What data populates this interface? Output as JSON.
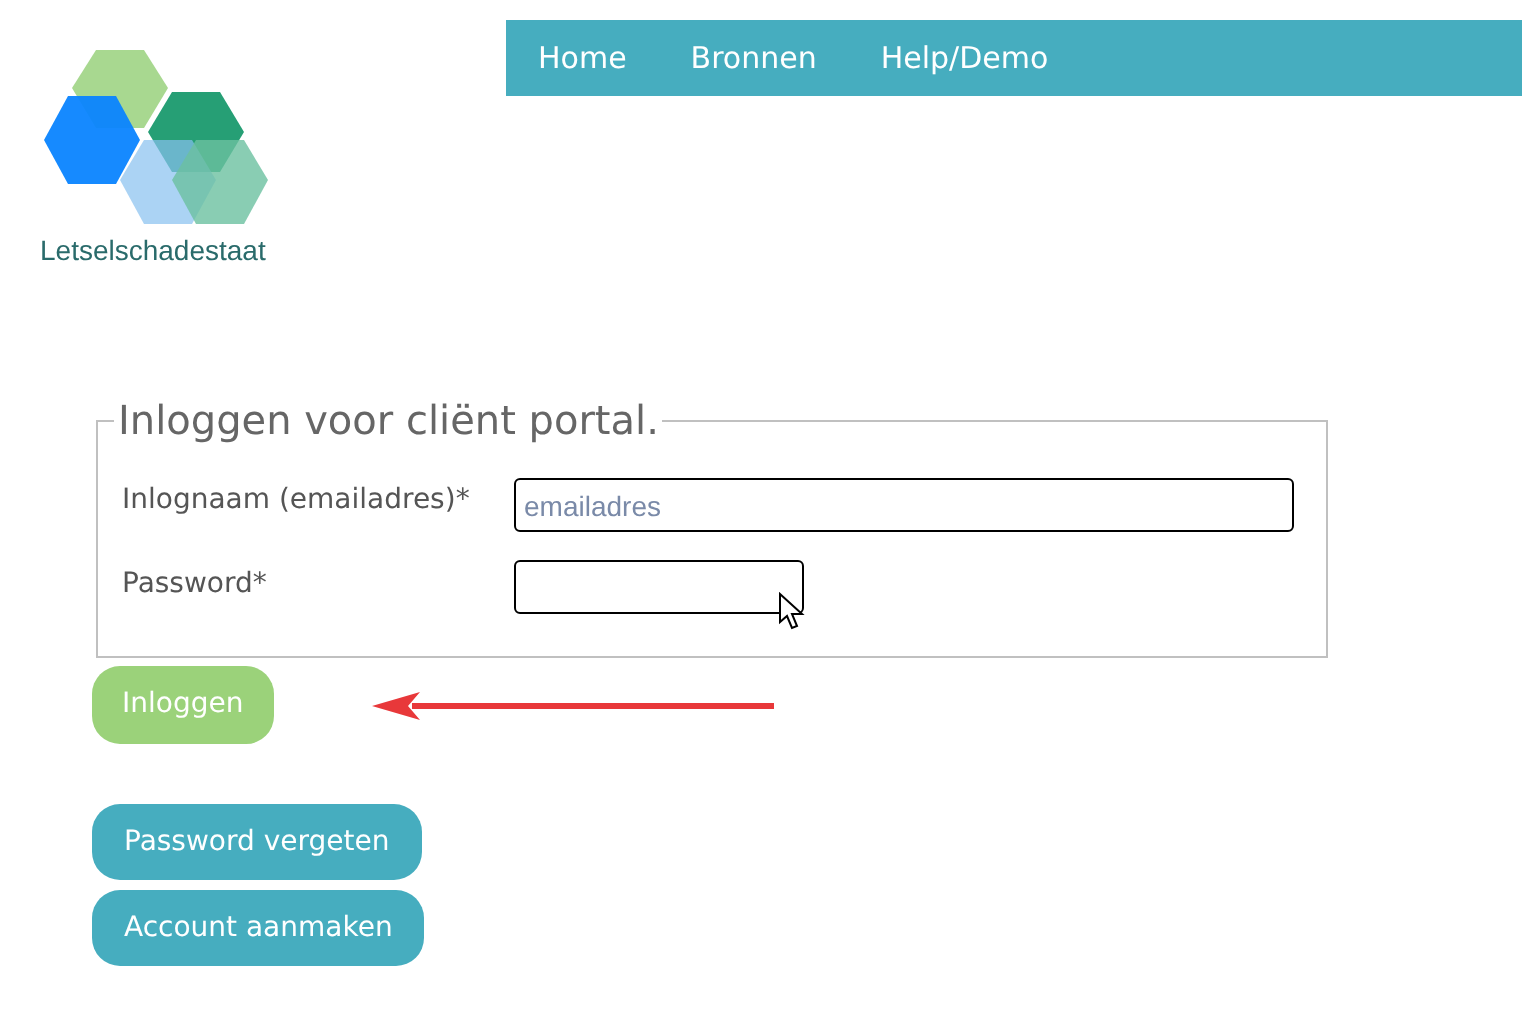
{
  "logo": {
    "name": "Letselschadestaat"
  },
  "nav": {
    "items": [
      {
        "label": "Home"
      },
      {
        "label": "Bronnen"
      },
      {
        "label": "Help/Demo"
      }
    ]
  },
  "login_form": {
    "legend": "Inloggen voor cliënt portal.",
    "fields": [
      {
        "label": "Inlognaam (emailadres)",
        "required_mark": "*",
        "placeholder": "emailadres",
        "kind": "wide"
      },
      {
        "label": "Password",
        "required_mark": "*",
        "kind": "narrow"
      }
    ],
    "submit": "Inloggen"
  },
  "links": [
    {
      "label": "Password vergeten"
    },
    {
      "label": "Account aanmaken"
    }
  ]
}
